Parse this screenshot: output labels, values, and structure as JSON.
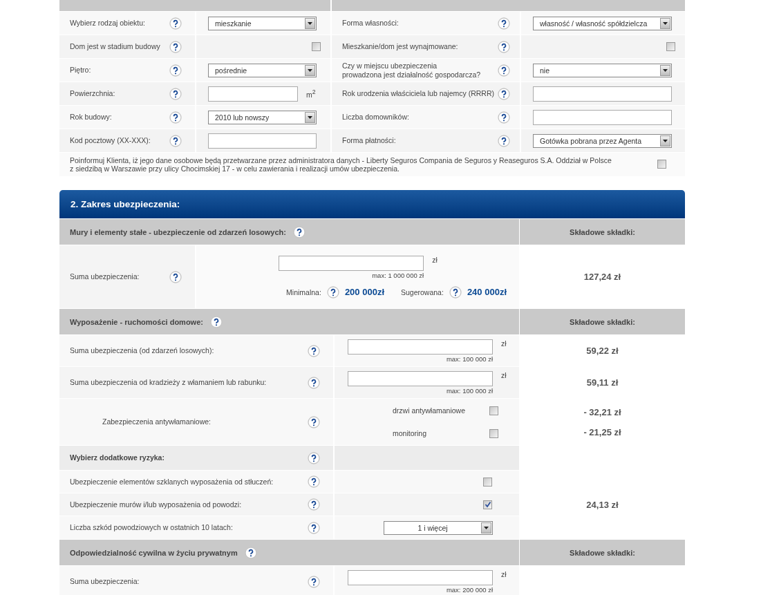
{
  "form_rows": [
    {
      "left": {
        "label": "Wybierz rodzaj obiektu:",
        "kind": "select",
        "value": "mieszkanie"
      },
      "right": {
        "label": "Forma własności:",
        "kind": "select",
        "value": "własność / własność spółdzielcza"
      }
    },
    {
      "left": {
        "label": "Dom jest w stadium budowy",
        "kind": "checkbox",
        "checked": false
      },
      "right": {
        "label": "Mieszkanie/dom jest wynajmowane:",
        "kind": "checkbox",
        "checked": false
      }
    },
    {
      "left": {
        "label": "Piętro:",
        "kind": "select",
        "value": "pośrednie"
      },
      "right": {
        "label": "Czy w miejscu ubezpieczenia\nprowadzona jest działalność gospodarcza?",
        "kind": "select",
        "value": "nie"
      }
    },
    {
      "left": {
        "label": "Powierzchnia:",
        "kind": "input",
        "unit": "m$^{2}$"
      },
      "right": {
        "label": "Rok urodzenia właściciela lub najemcy (RRRR)",
        "kind": "input"
      }
    },
    {
      "left": {
        "label": "Rok budowy:",
        "kind": "select",
        "value": "2010 lub nowszy"
      },
      "right": {
        "label": "Liczba domowników:",
        "kind": "input"
      }
    },
    {
      "left": {
        "label": "Kod pocztowy (XX-XXX):",
        "kind": "input"
      },
      "right": {
        "label": "Forma płatności:",
        "kind": "select",
        "value": "Gotówka pobrana przez Agenta"
      }
    }
  ],
  "consent": {
    "text": "Poinformuj Klienta, iż jego dane osobowe będą przetwarzane przez administratora danych - Liberty Seguros Compania de Seguros y Reaseguros S.A. Oddział w Polsce\nz siedzibą w Warszawie przy ulicy Chocimskiej 17 - w celu zawierania i realizacji umów ubezpieczenia.",
    "checked": false
  },
  "section": {
    "title": "2. Zakres ubezpieczenia:",
    "blocks": [
      {
        "title": "Mury i elementy stałe - ubezpieczenie od zdarzeń losowych:",
        "premium_heading": "Składowe składki:",
        "rows": [
          {
            "kind": "sum",
            "label": "Suma ubezpieczenia:",
            "currency": "zł",
            "max": "max: 1 000 000 zł",
            "minimal_label": "Minimalna:",
            "minimal": "200 000zł",
            "suggested_label": "Sugerowana:",
            "suggested": "240 000zł",
            "premiums": [
              "127,24 zł"
            ]
          }
        ]
      },
      {
        "title": "Wyposażenie - ruchomości domowe:",
        "premium_heading": "Składowe składki:",
        "rows": [
          {
            "kind": "amount",
            "label": "Suma ubezpieczenia (od zdarzeń losowych):",
            "currency": "zł",
            "max": "max: 100 000 zł",
            "premiums": [
              "59,22 zł"
            ]
          },
          {
            "kind": "amount",
            "label": "Suma ubezpieczenia od kradzieży z włamaniem lub rabunku:",
            "currency": "zł",
            "max": "max: 100 000 zł",
            "premiums": [
              "59,11 zł"
            ]
          },
          {
            "kind": "checks",
            "label": "Zabezpieczenia antywłamaniowe:",
            "options": [
              {
                "label": "drzwi antywłamaniowe",
                "checked": false
              },
              {
                "label": "monitoring",
                "checked": false
              }
            ],
            "premiums": [
              "- 32,21 zł",
              "- 21,25 zł"
            ]
          },
          {
            "kind": "subheading",
            "label": "Wybierz dodatkowe ryzyka:"
          },
          {
            "kind": "check",
            "label": "Ubezpieczenie elementów szklanych wyposażenia od stłuczeń:",
            "checked": false
          },
          {
            "kind": "check",
            "label": "Ubezpieczenie murów i/lub wyposażenia od powodzi:",
            "checked": true,
            "premiums": [
              "24,13 zł"
            ]
          },
          {
            "kind": "select",
            "label": "Liczba szkód powodziowych w ostatnich 10 latach:",
            "value": "1 i więcej"
          }
        ]
      },
      {
        "title": "Odpowiedzialność cywilna w życiu prywatnym",
        "premium_heading": "Składowe składki:",
        "rows": [
          {
            "kind": "amount",
            "label": "Suma ubezpieczenia:",
            "currency": "zł",
            "max": "max: 200 000 zł"
          }
        ]
      }
    ]
  }
}
